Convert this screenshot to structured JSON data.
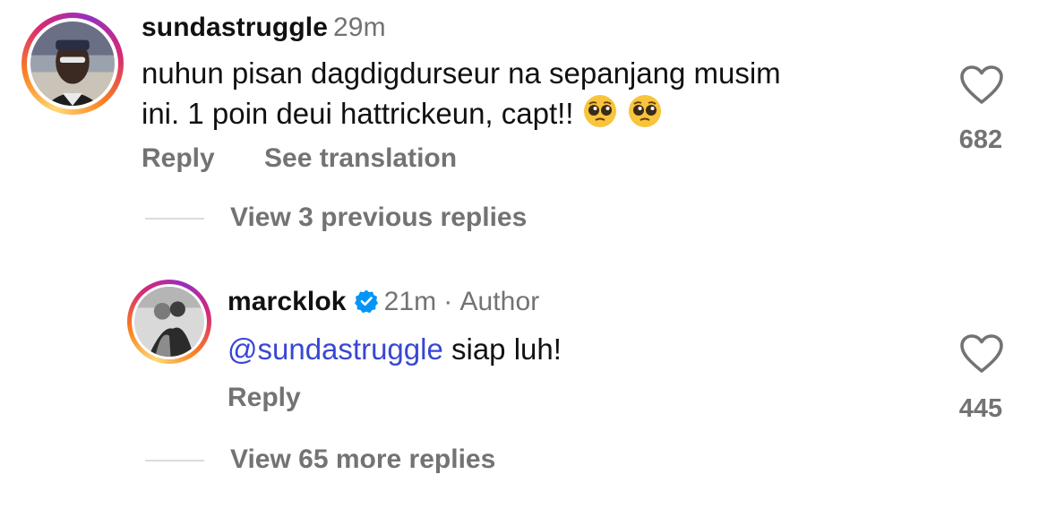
{
  "comments": [
    {
      "username": "sundastruggle",
      "time": "29m",
      "text": "nuhun pisan dagdigdurseur na sepanjang musim ini. 1 poin deui hattrickeun, capt!!",
      "text_line1": "nuhun pisan dagdigdurseur na sepanjang musim",
      "text_line2": "ini. 1 poin deui hattrickeun, capt!!",
      "emojis": [
        "pleading-face",
        "pleading-face"
      ],
      "actions": {
        "reply": "Reply",
        "translate": "See translation"
      },
      "likes": "682",
      "view_replies": "View 3 previous replies"
    },
    {
      "username": "marcklok",
      "verified": true,
      "time": "21m",
      "separator": "·",
      "author_label": "Author",
      "mention": "@sundastruggle",
      "text": "siap luh!",
      "actions": {
        "reply": "Reply"
      },
      "likes": "445",
      "view_replies": "View 65 more replies"
    }
  ],
  "colors": {
    "text": "#111111",
    "secondary": "#737373",
    "mention": "#3847d4",
    "verified": "#0095f6",
    "divider": "#dbdbdb"
  }
}
